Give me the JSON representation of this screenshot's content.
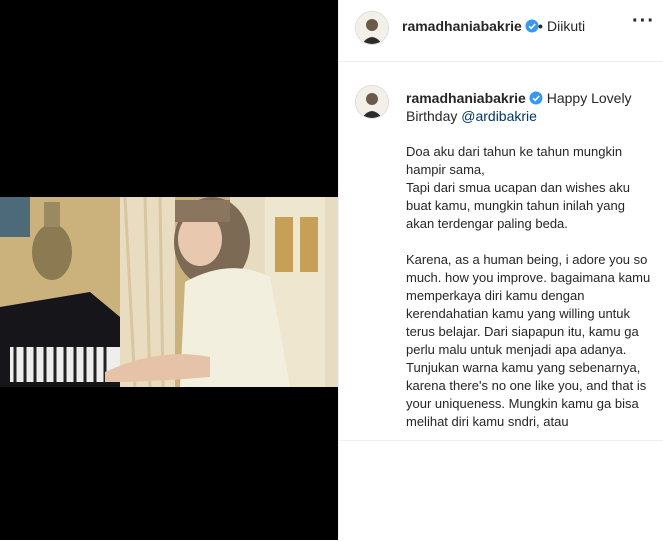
{
  "header": {
    "username": "ramadhaniabakrie",
    "separator": "•",
    "follow_status": "Diikuti",
    "more_icon": "more-horizontal-icon"
  },
  "caption": {
    "username": "ramadhaniabakrie",
    "text_before": "Happy Lovely Birthday",
    "mention": "@ardibakrie",
    "paragraph1": "Doa aku dari tahun ke tahun mungkin hampir sama,\nTapi dari smua ucapan dan wishes aku buat kamu, mungkin tahun inilah yang akan terdengar paling beda.",
    "paragraph2": "Karena, as a human being, i adore you so much. how you improve. bagaimana kamu memperkaya diri kamu dengan kerendahatian kamu yang willing untuk terus belajar. Dari siapapun itu, kamu ga perlu malu untuk menjadi apa adanya. Tunjukan warna kamu yang sebenarnya, karena there's no one like you, and that is your uniqueness. Mungkin kamu ga bisa melihat diri kamu sndri, atau"
  },
  "colors": {
    "verified_blue": "#3897f0",
    "mention_blue": "#00376b"
  }
}
